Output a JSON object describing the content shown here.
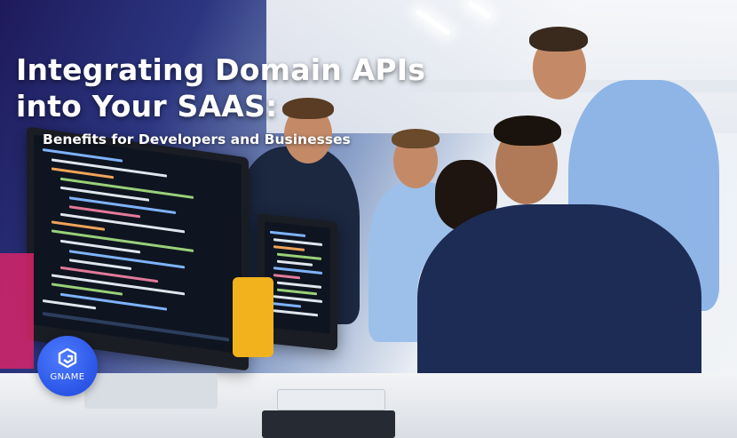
{
  "headline": {
    "line1": "Integrating Domain APIs",
    "line2": "into Your SAAS:"
  },
  "subheadline": "Benefits for Developers and Businesses",
  "brand": {
    "name": "GNAME",
    "icon": "gname-logo-icon",
    "color": "#2a55e6"
  }
}
